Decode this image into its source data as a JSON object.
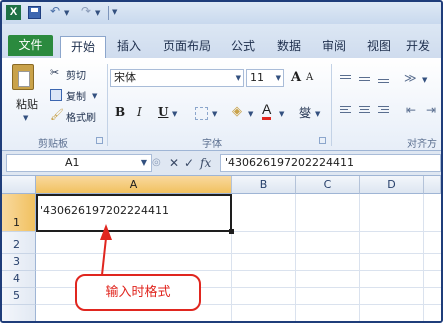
{
  "quick_access": {
    "excel_logo_text": "X",
    "icons": [
      "excel-logo-icon",
      "save-icon",
      "undo-icon",
      "redo-icon",
      "customize-qat-icon"
    ]
  },
  "tabs": {
    "file": "文件",
    "items": [
      "开始",
      "插入",
      "页面布局",
      "公式",
      "数据",
      "审阅",
      "视图",
      "开发"
    ],
    "active_index": 0,
    "file_color": "#2b8a3e"
  },
  "ribbon": {
    "clipboard": {
      "paste": "粘贴",
      "cut": "剪切",
      "copy": "复制",
      "format_painter": "格式刷",
      "group_label": "剪贴板"
    },
    "font": {
      "font_name": "宋体",
      "font_size": "11",
      "bold": "B",
      "italic": "I",
      "underline": "U",
      "grow": "A",
      "shrink": "A",
      "font_color_label": "A",
      "phonetic": "燮",
      "group_label": "字体"
    },
    "alignment": {
      "group_label": "对齐方"
    }
  },
  "formula_bar": {
    "name_box": "A1",
    "cancel": "✕",
    "enter": "✓",
    "fx": "fx",
    "content": "'430626197202224411"
  },
  "sheet": {
    "columns": [
      "A",
      "B",
      "C",
      "D"
    ],
    "rows": [
      "1",
      "2",
      "3",
      "4",
      "5"
    ],
    "selected_cell": "A1",
    "cell_a1": "'430626197202224411"
  },
  "annotation": {
    "callout_text": "输入时格式",
    "color": "#e0261f"
  }
}
